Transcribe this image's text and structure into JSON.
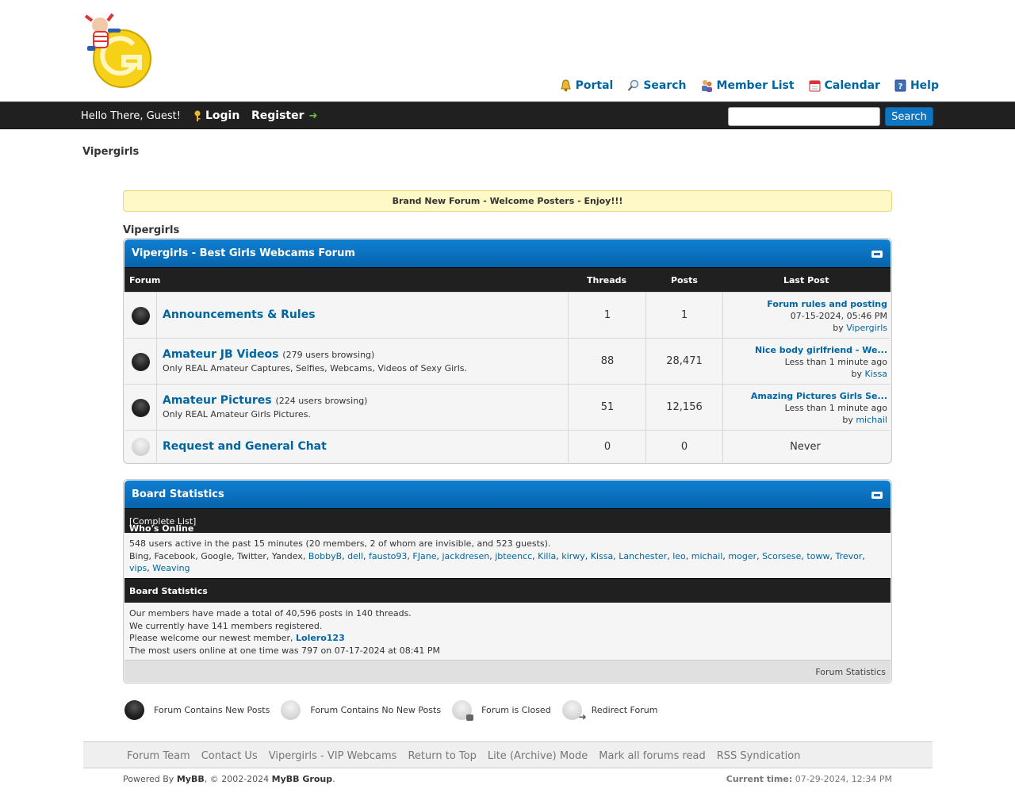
{
  "header": {
    "menu": [
      {
        "label": "Portal",
        "icon": "bell-icon"
      },
      {
        "label": "Search",
        "icon": "search-icon"
      },
      {
        "label": "Member List",
        "icon": "members-icon"
      },
      {
        "label": "Calendar",
        "icon": "calendar-icon"
      },
      {
        "label": "Help",
        "icon": "help-icon"
      }
    ]
  },
  "panel": {
    "greeting": "Hello There, Guest!",
    "login": "Login",
    "register": "Register",
    "search_button": "Search",
    "search_placeholder": ""
  },
  "breadcrumb": "Vipergirls",
  "announcement": "Brand New Forum - Welcome Posters - Enjoy!!!",
  "category": {
    "label": "Vipergirls",
    "title": "Vipergirls - Best Girls Webcams Forum",
    "columns": {
      "forum": "Forum",
      "threads": "Threads",
      "posts": "Posts",
      "last_post": "Last Post"
    },
    "forums": [
      {
        "name": "Announcements & Rules",
        "browsing": "",
        "desc": "",
        "threads": "1",
        "posts": "1",
        "last_title": "Forum rules and posting",
        "last_time": "07-15-2024, 05:46 PM",
        "by": "by ",
        "last_user": "Vipergirls",
        "new": true
      },
      {
        "name": "Amateur JB Videos",
        "browsing": "(279 users browsing)",
        "desc": "Only REAL Amateur Captures, Selfies, Webcams, Videos of Sexy Girls.",
        "threads": "88",
        "posts": "28,471",
        "last_title": "Nice body girlfriend - We...",
        "last_time": "Less than 1 minute ago",
        "by": "by ",
        "last_user": "Kissa",
        "new": true
      },
      {
        "name": "Amateur Pictures",
        "browsing": "(224 users browsing)",
        "desc": "Only REAL Amateur Girls Pictures.",
        "threads": "51",
        "posts": "12,156",
        "last_title": "Amazing Pictures Girls Se...",
        "last_time": "Less than 1 minute ago",
        "by": "by ",
        "last_user": "michail",
        "new": true
      },
      {
        "name": "Request and General Chat",
        "browsing": "",
        "desc": "",
        "threads": "0",
        "posts": "0",
        "never": "Never",
        "new": false
      }
    ]
  },
  "stats": {
    "title": "Board Statistics",
    "whos_online": "Who's Online",
    "complete_list": "[Complete List]",
    "online_summary": "548 users active in the past 15 minutes (20 members, 2 of whom are invisible, and 523 guests).",
    "bots": "Bing, Facebook, Google, Twitter, Yandex, ",
    "members": [
      "BobbyB",
      "dell",
      "fausto93",
      "FJane",
      "jackdresen",
      "jbteencc",
      "Killa",
      "kirwy",
      "Kissa",
      "Lanchester",
      "leo",
      "michail",
      "moger",
      "Scorsese",
      "toww",
      "Trevor",
      "vips",
      "Weaving"
    ],
    "board_stats_label": "Board Statistics",
    "line1": "Our members have made a total of 40,596 posts in 140 threads.",
    "line2": "We currently have 141 members registered.",
    "line3_prefix": "Please welcome our newest member, ",
    "newest_member": "Lolero123",
    "line4": "The most users online at one time was 797 on 07-17-2024 at 08:41 PM",
    "footer_link": "Forum Statistics"
  },
  "legend": [
    {
      "label": "Forum Contains New Posts",
      "type": "on"
    },
    {
      "label": "Forum Contains No New Posts",
      "type": "off"
    },
    {
      "label": "Forum is Closed",
      "type": "closed"
    },
    {
      "label": "Redirect Forum",
      "type": "redirect"
    }
  ],
  "footer": {
    "links": [
      "Forum Team",
      "Contact Us",
      "Vipergirls - VIP Webcams",
      "Return to Top",
      "Lite (Archive) Mode",
      "Mark all forums read",
      "RSS Syndication"
    ],
    "powered_prefix": "Powered By ",
    "mybb": "MyBB",
    "copy_mid": ", © 2002-2024 ",
    "mybb_group": "MyBB Group",
    "copy_end": ".",
    "current_time_label": "Current time:",
    "current_time": "07-29-2024, 12:34 PM"
  },
  "colors": {
    "accent": "#0066a2",
    "header_blue": "#0664ab",
    "dark_bar": "#202020",
    "announce_bg": "#fff9c8"
  }
}
